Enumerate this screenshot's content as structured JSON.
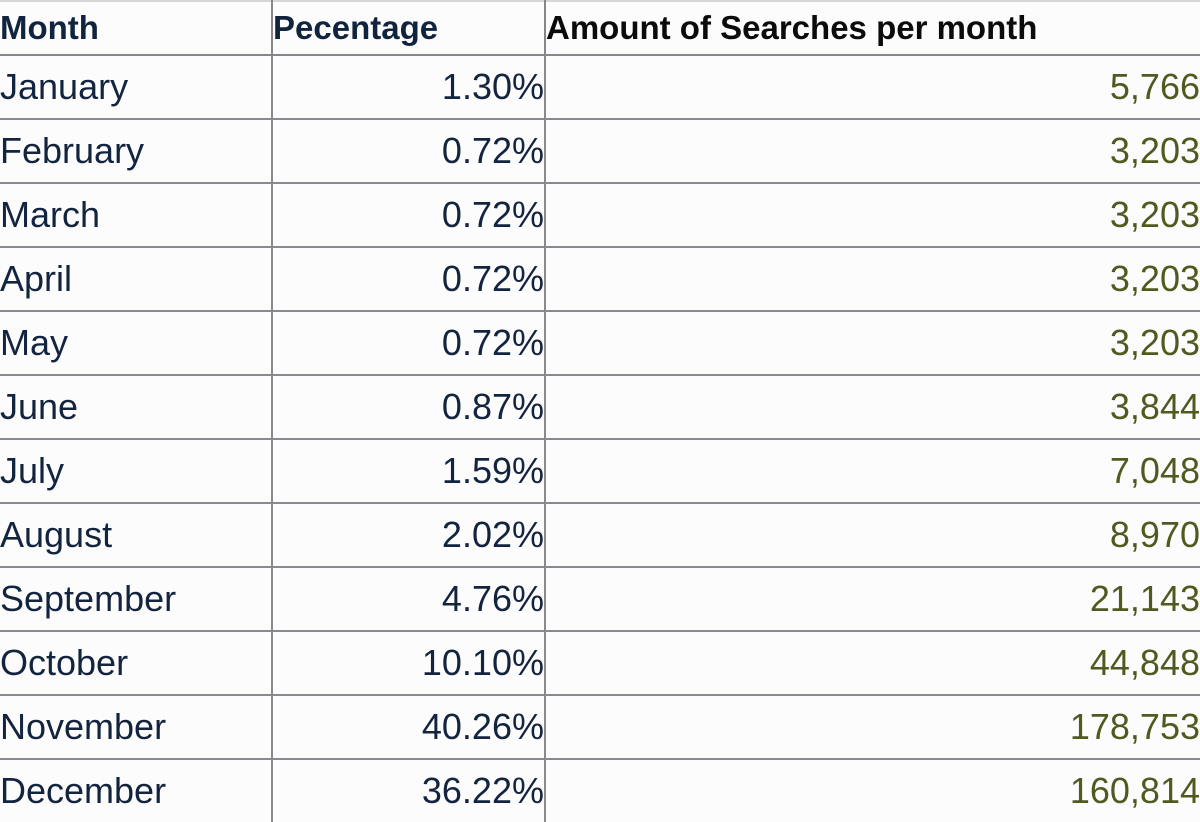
{
  "table": {
    "columns": [
      {
        "key": "month",
        "label": "Month"
      },
      {
        "key": "pct",
        "label": "Pecentage"
      },
      {
        "key": "amount",
        "label": "Amount of Searches per month"
      }
    ],
    "rows": [
      {
        "month": "January",
        "pct": "1.30%",
        "amount": "5,766"
      },
      {
        "month": "February",
        "pct": "0.72%",
        "amount": "3,203"
      },
      {
        "month": "March",
        "pct": "0.72%",
        "amount": "3,203"
      },
      {
        "month": "April",
        "pct": "0.72%",
        "amount": "3,203"
      },
      {
        "month": "May",
        "pct": "0.72%",
        "amount": "3,203"
      },
      {
        "month": "June",
        "pct": "0.87%",
        "amount": "3,844"
      },
      {
        "month": "July",
        "pct": "1.59%",
        "amount": "7,048"
      },
      {
        "month": "August",
        "pct": "2.02%",
        "amount": "8,970"
      },
      {
        "month": "September",
        "pct": "4.76%",
        "amount": "21,143"
      },
      {
        "month": "October",
        "pct": "10.10%",
        "amount": "44,848"
      },
      {
        "month": "November",
        "pct": "40.26%",
        "amount": "178,753"
      },
      {
        "month": "December",
        "pct": "36.22%",
        "amount": "160,814"
      }
    ]
  },
  "colors": {
    "header_text_primary": "#10243e",
    "header_text_amount": "#0b0b0b",
    "month_text": "#13243f",
    "percent_text": "#13243f",
    "amount_text": "#4e5a1f",
    "border": "#8a8a8e",
    "cell_background": "#fcfcfd"
  },
  "chart_data": {
    "type": "table",
    "title": "Amount of Searches per month",
    "categories": [
      "January",
      "February",
      "March",
      "April",
      "May",
      "June",
      "July",
      "August",
      "September",
      "October",
      "November",
      "December"
    ],
    "series": [
      {
        "name": "Pecentage",
        "values": [
          1.3,
          0.72,
          0.72,
          0.72,
          0.72,
          0.87,
          1.59,
          2.02,
          4.76,
          10.1,
          40.26,
          36.22
        ],
        "unit": "%"
      },
      {
        "name": "Amount of Searches per month",
        "values": [
          5766,
          3203,
          3203,
          3203,
          3203,
          3844,
          7048,
          8970,
          21143,
          44848,
          178753,
          160814
        ],
        "unit": "searches"
      }
    ],
    "xlabel": "Month",
    "ylabel": "Amount of Searches per month"
  }
}
